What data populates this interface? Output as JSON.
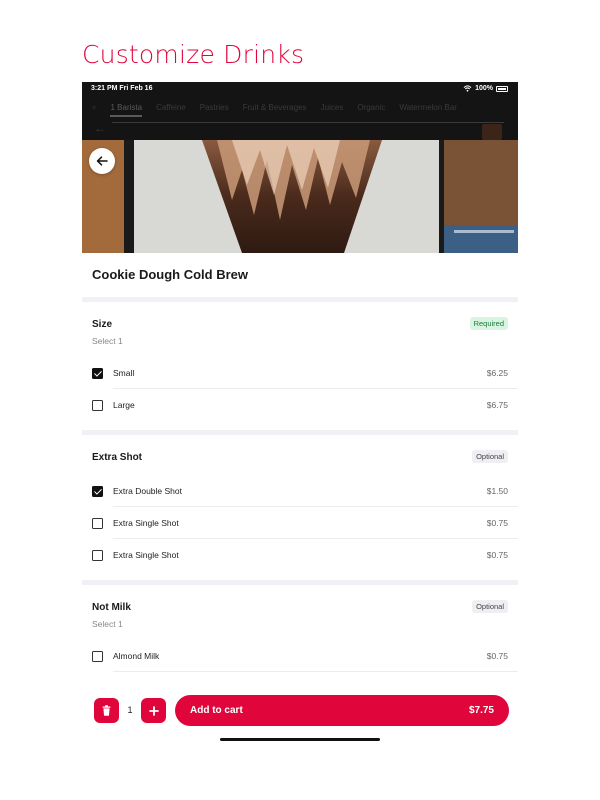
{
  "page": {
    "heading": "Customize Drinks"
  },
  "status_bar": {
    "time": "3:21 PM   Fri Feb 16",
    "battery": "100%"
  },
  "background_nav": {
    "tabs": [
      "1 Barista",
      "Caffeine",
      "Pastries",
      "Fruit & Beverages",
      "Juices",
      "Organic",
      "Watermelon Bar"
    ]
  },
  "item": {
    "name": "Cookie Dough Cold Brew",
    "image_icon": "drink-photo"
  },
  "sections": [
    {
      "title": "Size",
      "subtitle": "Select 1",
      "badge": "Required",
      "options": [
        {
          "label": "Small",
          "price": "$6.25",
          "checked": true
        },
        {
          "label": "Large",
          "price": "$6.75",
          "checked": false
        }
      ]
    },
    {
      "title": "Extra Shot",
      "subtitle": "",
      "badge": "Optional",
      "options": [
        {
          "label": "Extra Double Shot",
          "price": "$1.50",
          "checked": true
        },
        {
          "label": "Extra Single Shot",
          "price": "$0.75",
          "checked": false
        },
        {
          "label": "Extra Single Shot",
          "price": "$0.75",
          "checked": false
        }
      ]
    },
    {
      "title": "Not Milk",
      "subtitle": "Select 1",
      "badge": "Optional",
      "options": [
        {
          "label": "Almond Milk",
          "price": "$0.75",
          "checked": false
        }
      ]
    }
  ],
  "cart": {
    "quantity": "1",
    "add_label": "Add to cart",
    "total": "$7.75"
  },
  "colors": {
    "accent": "#e0063c",
    "required_badge_bg": "#d9f5e2",
    "optional_badge_bg": "#efeff3"
  },
  "icons": {
    "back": "arrow-left-icon",
    "delete": "trash-icon",
    "plus": "plus-icon",
    "wifi": "wifi-icon",
    "battery": "battery-icon"
  }
}
